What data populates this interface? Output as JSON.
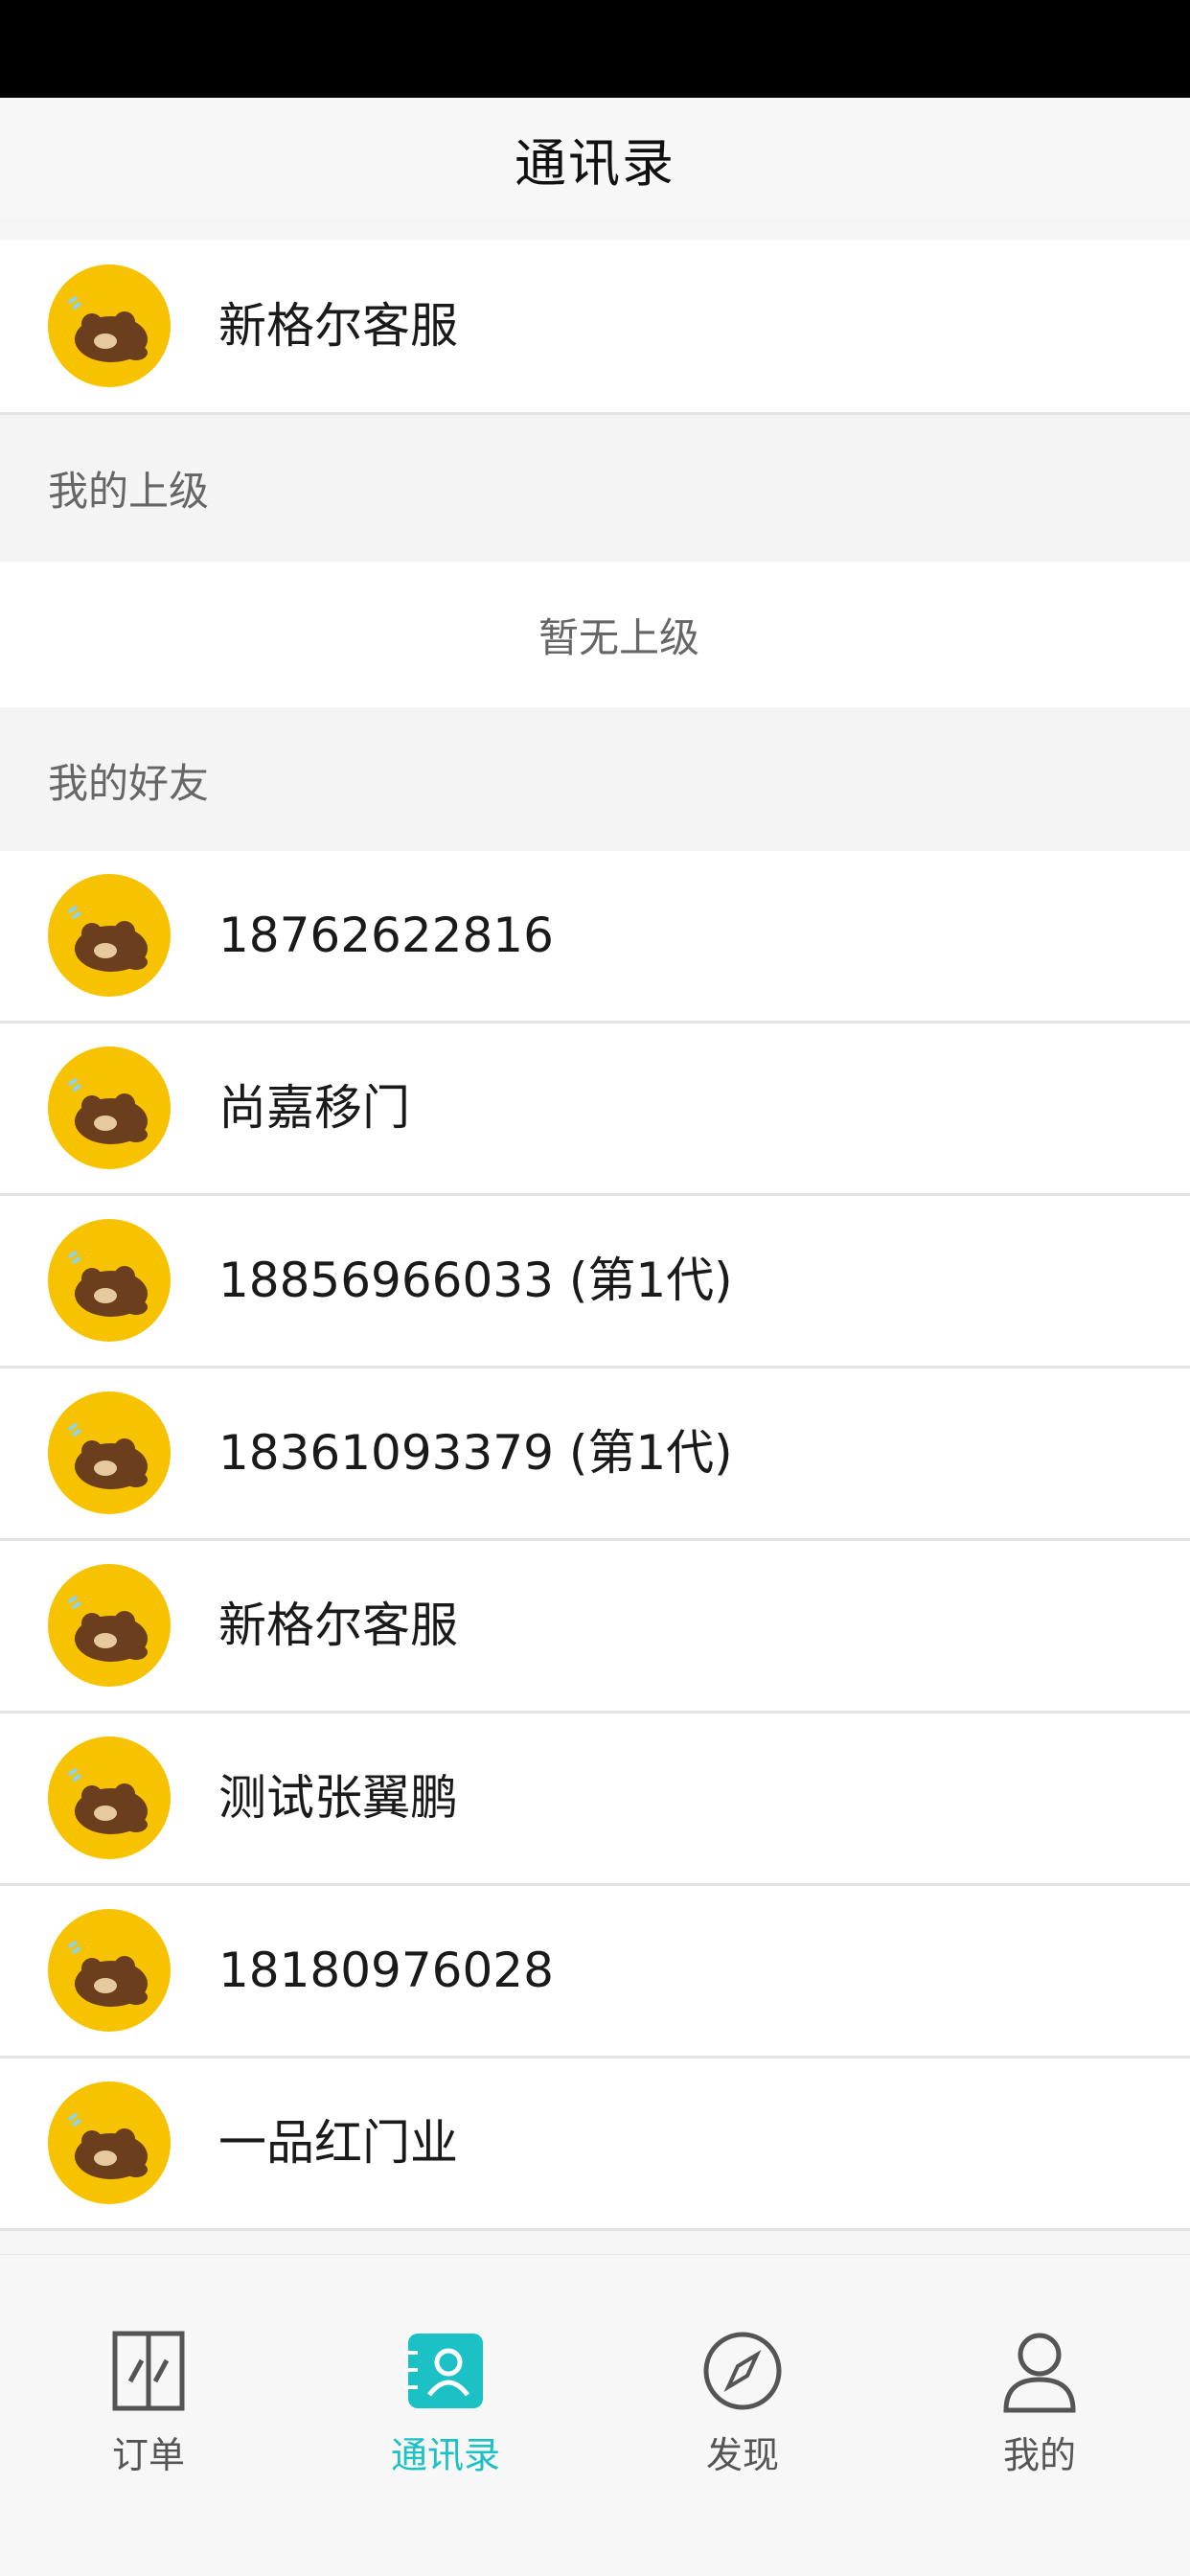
{
  "header": {
    "title": "通讯录"
  },
  "service_contact": {
    "name": "新格尔客服"
  },
  "superior_section": {
    "title": "我的上级",
    "empty_text": "暂无上级"
  },
  "friends_section": {
    "title": "我的好友",
    "items": [
      {
        "name": "18762622816"
      },
      {
        "name": "尚嘉移门"
      },
      {
        "name": "18856966033 (第1代)"
      },
      {
        "name": "18361093379 (第1代)"
      },
      {
        "name": "新格尔客服"
      },
      {
        "name": "测试张翼鹏"
      },
      {
        "name": "18180976028"
      },
      {
        "name": "一品红门业"
      }
    ]
  },
  "tabbar": {
    "tabs": [
      {
        "label": "订单",
        "icon": "door-icon",
        "active": false
      },
      {
        "label": "通讯录",
        "icon": "contacts-book-icon",
        "active": true
      },
      {
        "label": "发现",
        "icon": "compass-icon",
        "active": false
      },
      {
        "label": "我的",
        "icon": "person-icon",
        "active": false
      }
    ]
  },
  "colors": {
    "accent": "#1cc1c5",
    "avatar_bg": "#f7c200"
  }
}
